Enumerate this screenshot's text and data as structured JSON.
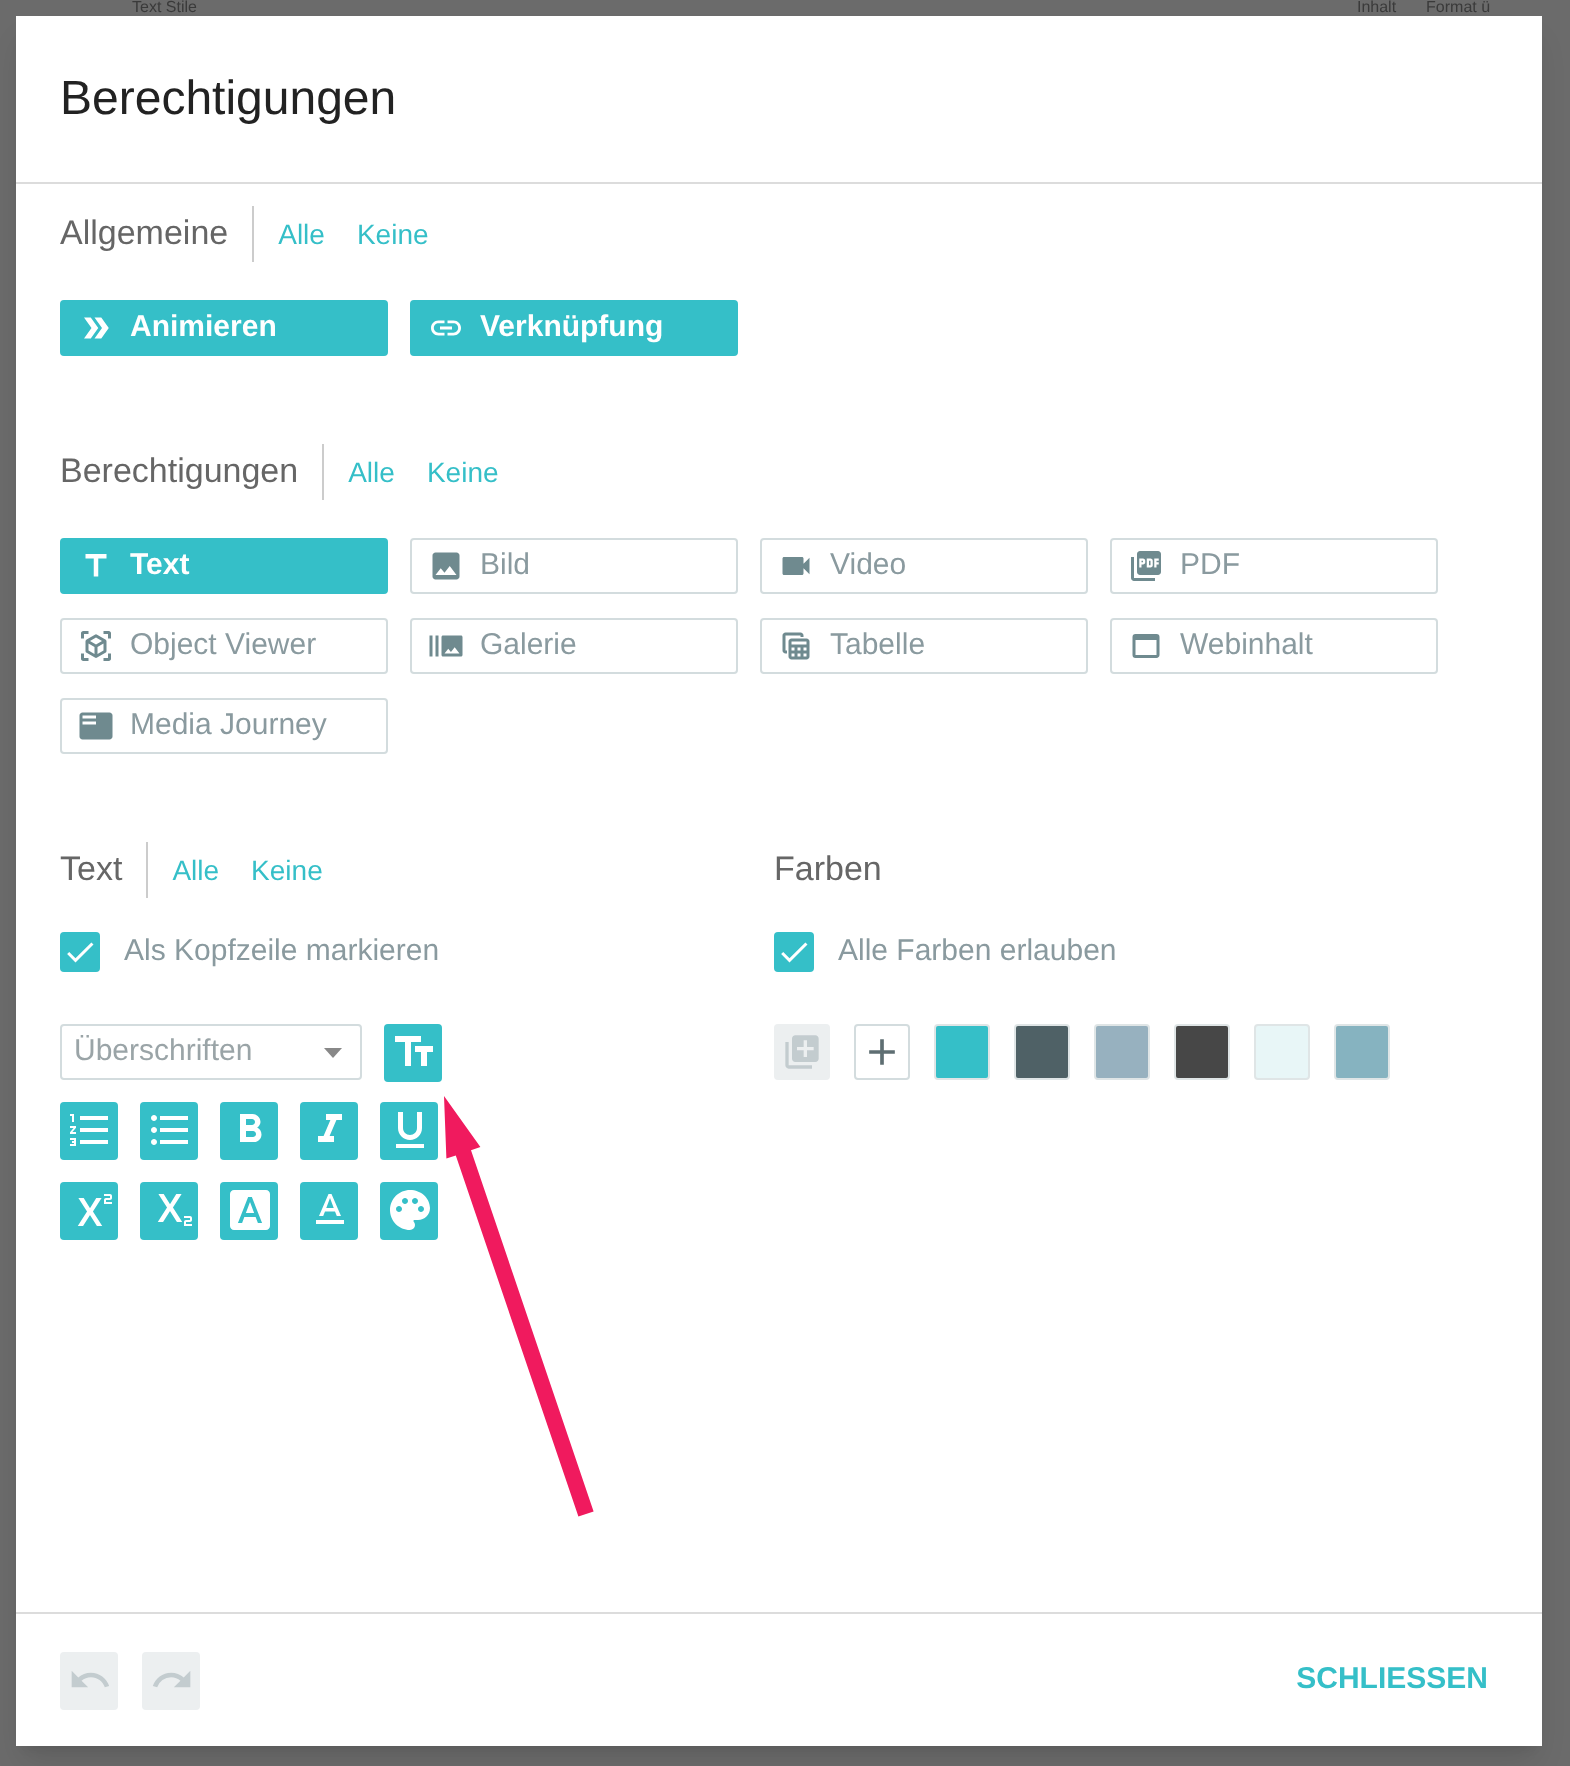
{
  "background": {
    "texts": [
      "Text Stile",
      "Inhalt",
      "Format ü"
    ]
  },
  "dialog": {
    "title": "Berechtigungen",
    "general": {
      "label": "Allgemeine",
      "all": "Alle",
      "none": "Keine",
      "items": [
        {
          "label": "Animieren",
          "selected": true
        },
        {
          "label": "Verknüpfung",
          "selected": true
        }
      ]
    },
    "permissions": {
      "label": "Berechtigungen",
      "all": "Alle",
      "none": "Keine",
      "items": [
        {
          "label": "Text",
          "selected": true
        },
        {
          "label": "Bild",
          "selected": false
        },
        {
          "label": "Video",
          "selected": false
        },
        {
          "label": "PDF",
          "selected": false
        },
        {
          "label": "Object Viewer",
          "selected": false
        },
        {
          "label": "Galerie",
          "selected": false
        },
        {
          "label": "Tabelle",
          "selected": false
        },
        {
          "label": "Webinhalt",
          "selected": false
        },
        {
          "label": "Media Journey",
          "selected": false
        }
      ]
    },
    "text": {
      "label": "Text",
      "all": "Alle",
      "none": "Keine",
      "header_checkbox": {
        "label": "Als Kopfzeile markieren",
        "checked": true
      },
      "heading_select": {
        "placeholder": "Überschriften"
      }
    },
    "colors": {
      "label": "Farben",
      "allow_all": {
        "label": "Alle Farben erlauben",
        "checked": true
      },
      "swatches": [
        {
          "color": "#35bfc8"
        },
        {
          "color": "#4f6166"
        },
        {
          "color": "#97b1bf"
        },
        {
          "color": "#474747"
        },
        {
          "color": "#e8f6f7"
        },
        {
          "color": "#86b3c0"
        }
      ]
    },
    "footer": {
      "undo_disabled": true,
      "redo_disabled": true,
      "close": "SCHLIESSEN"
    }
  }
}
